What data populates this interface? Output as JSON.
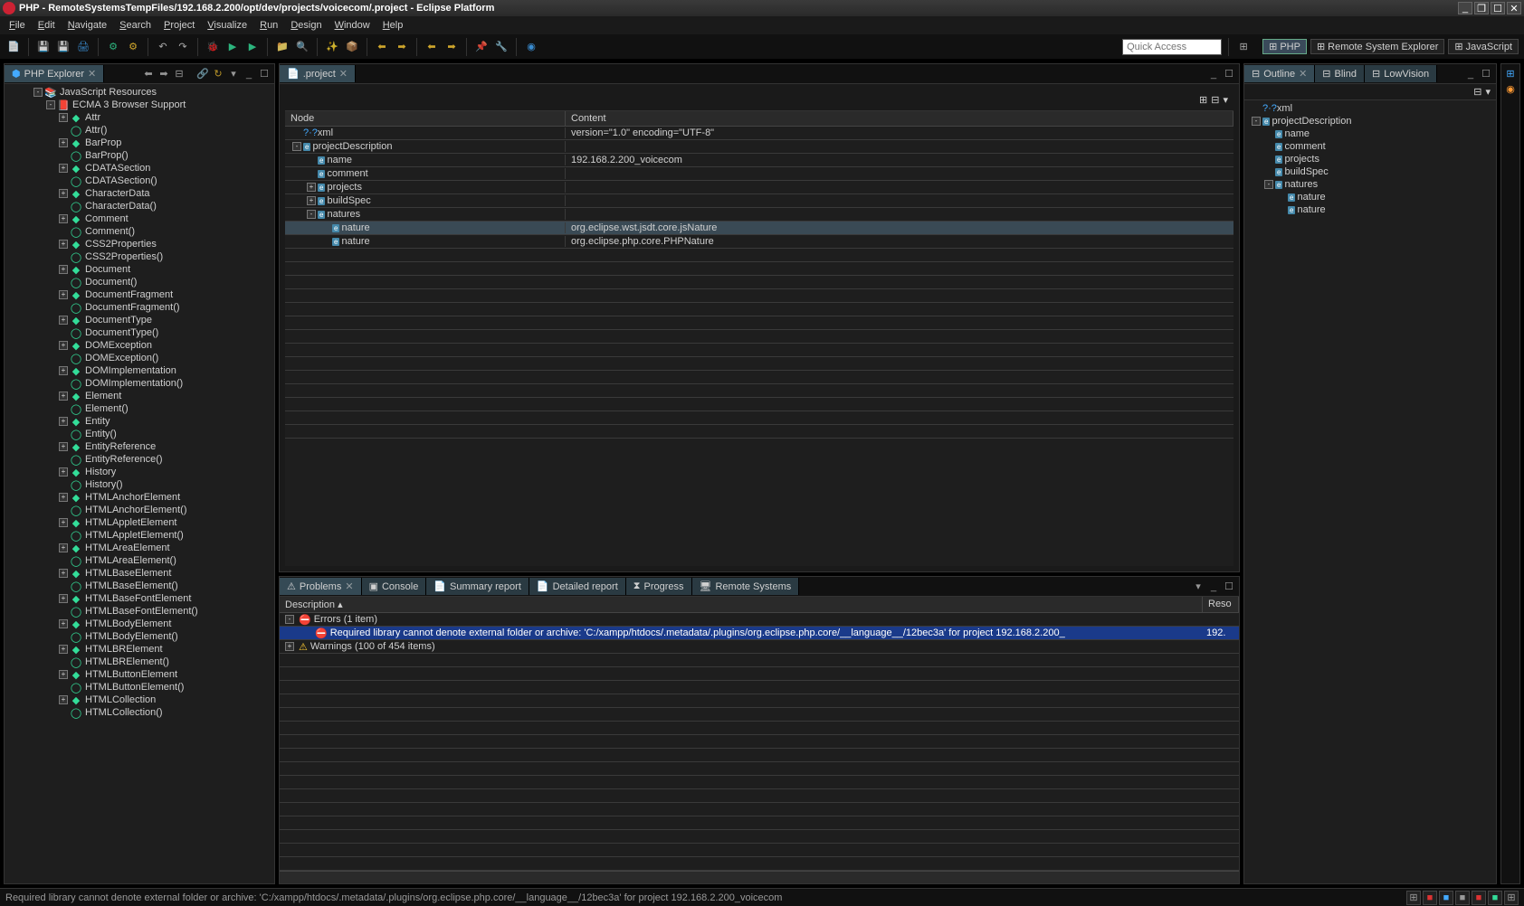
{
  "title": "PHP - RemoteSystemsTempFiles/192.168.2.200/opt/dev/projects/voicecom/.project - Eclipse Platform",
  "menu": [
    "File",
    "Edit",
    "Navigate",
    "Search",
    "Project",
    "Visualize",
    "Run",
    "Design",
    "Window",
    "Help"
  ],
  "quickaccess": "Quick Access",
  "perspectives": [
    {
      "id": "php",
      "label": "PHP",
      "active": true
    },
    {
      "id": "rse",
      "label": "Remote System Explorer",
      "active": false
    },
    {
      "id": "js",
      "label": "JavaScript",
      "active": false
    }
  ],
  "explorer": {
    "title": "PHP Explorer",
    "root": {
      "label": "JavaScript Resources",
      "icon": "lib",
      "exp": "-"
    },
    "sub": {
      "label": "ECMA 3 Browser Support",
      "icon": "book",
      "exp": "-"
    },
    "items": [
      "Attr",
      "Attr()",
      "BarProp",
      "BarProp()",
      "CDATASection",
      "CDATASection()",
      "CharacterData",
      "CharacterData()",
      "Comment",
      "Comment()",
      "CSS2Properties",
      "CSS2Properties()",
      "Document",
      "Document()",
      "DocumentFragment",
      "DocumentFragment()",
      "DocumentType",
      "DocumentType()",
      "DOMException",
      "DOMException()",
      "DOMImplementation",
      "DOMImplementation()",
      "Element",
      "Element()",
      "Entity",
      "Entity()",
      "EntityReference",
      "EntityReference()",
      "History",
      "History()",
      "HTMLAnchorElement",
      "HTMLAnchorElement()",
      "HTMLAppletElement",
      "HTMLAppletElement()",
      "HTMLAreaElement",
      "HTMLAreaElement()",
      "HTMLBaseElement",
      "HTMLBaseElement()",
      "HTMLBaseFontElement",
      "HTMLBaseFontElement()",
      "HTMLBodyElement",
      "HTMLBodyElement()",
      "HTMLBRElement",
      "HTMLBRElement()",
      "HTMLButtonElement",
      "HTMLButtonElement()",
      "HTMLCollection",
      "HTMLCollection()"
    ]
  },
  "editor": {
    "tab": ".project",
    "cols": {
      "c1": "Node",
      "c2": "Content"
    },
    "rows": [
      {
        "indent": 0,
        "exp": "",
        "icon": "?",
        "label": "xml",
        "content": "version=\"1.0\" encoding=\"UTF-8\"",
        "sel": false
      },
      {
        "indent": 0,
        "exp": "-",
        "icon": "e",
        "label": "projectDescription",
        "content": "",
        "sel": false
      },
      {
        "indent": 1,
        "exp": "",
        "icon": "e",
        "label": "name",
        "content": "192.168.2.200_voicecom",
        "sel": false
      },
      {
        "indent": 1,
        "exp": "",
        "icon": "e",
        "label": "comment",
        "content": "",
        "sel": false
      },
      {
        "indent": 1,
        "exp": "+",
        "icon": "e",
        "label": "projects",
        "content": "",
        "sel": false
      },
      {
        "indent": 1,
        "exp": "+",
        "icon": "e",
        "label": "buildSpec",
        "content": "",
        "sel": false
      },
      {
        "indent": 1,
        "exp": "-",
        "icon": "e",
        "label": "natures",
        "content": "",
        "sel": false
      },
      {
        "indent": 2,
        "exp": "",
        "icon": "e",
        "label": "nature",
        "content": "org.eclipse.wst.jsdt.core.jsNature",
        "sel": true
      },
      {
        "indent": 2,
        "exp": "",
        "icon": "e",
        "label": "nature",
        "content": "org.eclipse.php.core.PHPNature",
        "sel": false
      }
    ]
  },
  "problems": {
    "tabs": [
      {
        "label": "Problems",
        "icon": "err",
        "active": true
      },
      {
        "label": "Console",
        "icon": "con",
        "active": false
      },
      {
        "label": "Summary report",
        "icon": "doc",
        "active": false
      },
      {
        "label": "Detailed report",
        "icon": "doc",
        "active": false
      },
      {
        "label": "Progress",
        "icon": "prog",
        "active": false
      },
      {
        "label": "Remote Systems",
        "icon": "sys",
        "active": false
      }
    ],
    "cols": {
      "c1": "Description",
      "c2": "Reso"
    },
    "rows": [
      {
        "indent": 0,
        "exp": "-",
        "icon": "err",
        "label": "Errors (1 item)",
        "sel": false,
        "res": ""
      },
      {
        "indent": 1,
        "exp": "",
        "icon": "err",
        "label": "Required library cannot denote external folder or archive: 'C:/xampp/htdocs/.metadata/.plugins/org.eclipse.php.core/__language__/12bec3a' for project 192.168.2.200_",
        "sel": true,
        "res": "192."
      },
      {
        "indent": 0,
        "exp": "+",
        "icon": "warn",
        "label": "Warnings (100 of 454 items)",
        "sel": false,
        "res": ""
      }
    ]
  },
  "outline": {
    "tabs": [
      {
        "label": "Outline",
        "active": true
      },
      {
        "label": "Blind",
        "active": false
      },
      {
        "label": "LowVision",
        "active": false
      }
    ],
    "rows": [
      {
        "indent": 0,
        "exp": "",
        "icon": "?",
        "label": "xml"
      },
      {
        "indent": 0,
        "exp": "-",
        "icon": "e",
        "label": "projectDescription"
      },
      {
        "indent": 1,
        "exp": "",
        "icon": "e",
        "label": "name"
      },
      {
        "indent": 1,
        "exp": "",
        "icon": "e",
        "label": "comment"
      },
      {
        "indent": 1,
        "exp": "",
        "icon": "e",
        "label": "projects"
      },
      {
        "indent": 1,
        "exp": "",
        "icon": "e",
        "label": "buildSpec"
      },
      {
        "indent": 1,
        "exp": "-",
        "icon": "e",
        "label": "natures"
      },
      {
        "indent": 2,
        "exp": "",
        "icon": "e",
        "label": "nature"
      },
      {
        "indent": 2,
        "exp": "",
        "icon": "e",
        "label": "nature"
      }
    ]
  },
  "status": "Required library cannot denote external folder or archive: 'C:/xampp/htdocs/.metadata/.plugins/org.eclipse.php.core/__language__/12bec3a' for project 192.168.2.200_voicecom"
}
